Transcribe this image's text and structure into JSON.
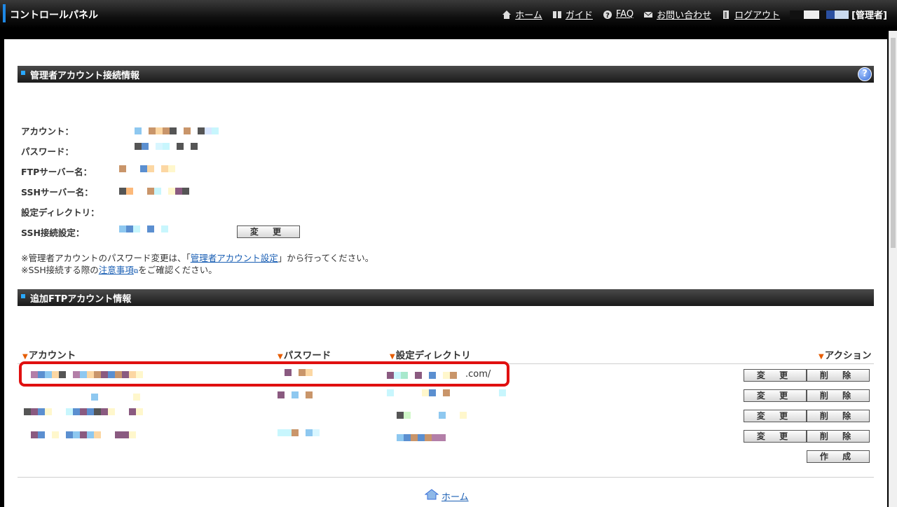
{
  "topbar": {
    "app_title": "コントロールパネル",
    "nav": {
      "home": "ホーム",
      "guide": "ガイド",
      "faq": "FAQ",
      "contact": "お問い合わせ",
      "logout": "ログアウト"
    },
    "user_role": "[管理者]"
  },
  "admin_section": {
    "title": "管理者アカウント接続情報",
    "labels": {
      "account": "アカウント：",
      "password": "パスワード：",
      "ftp_server": "FTPサーバー名：",
      "ssh_server": "SSHサーバー名：",
      "directory": "設定ディレクトリ：",
      "ssh_setting": "SSH接続設定："
    },
    "change_button": "変 更",
    "note1_prefix": "※管理者アカウントのパスワード変更は、「",
    "note1_link": "管理者アカウント設定",
    "note1_suffix": "」から行ってください。",
    "note2_prefix": "※SSH接続する際の",
    "note2_link": "注意事項",
    "note2_suffix": "をご確認ください。"
  },
  "ftp_section": {
    "title": "追加FTPアカウント情報",
    "columns": {
      "account": "アカウント",
      "password": "パスワード",
      "directory": "設定ディレクトリ",
      "action": "アクション"
    },
    "rows": [
      {
        "directory_suffix": ".com/",
        "edit": "変 更",
        "delete": "削 除"
      },
      {
        "directory_suffix": "",
        "edit": "変 更",
        "delete": "削 除"
      },
      {
        "directory_suffix": "",
        "edit": "変 更",
        "delete": "削 除"
      },
      {
        "directory_suffix": "",
        "edit": "変 更",
        "delete": "削 除"
      }
    ],
    "create_button": "作 成"
  },
  "footer": {
    "home": "ホーム"
  },
  "colors": {
    "accent": "#1e88e5",
    "highlight": "#e01010",
    "link": "#1a5fb4",
    "triangle": "#e65c00"
  }
}
